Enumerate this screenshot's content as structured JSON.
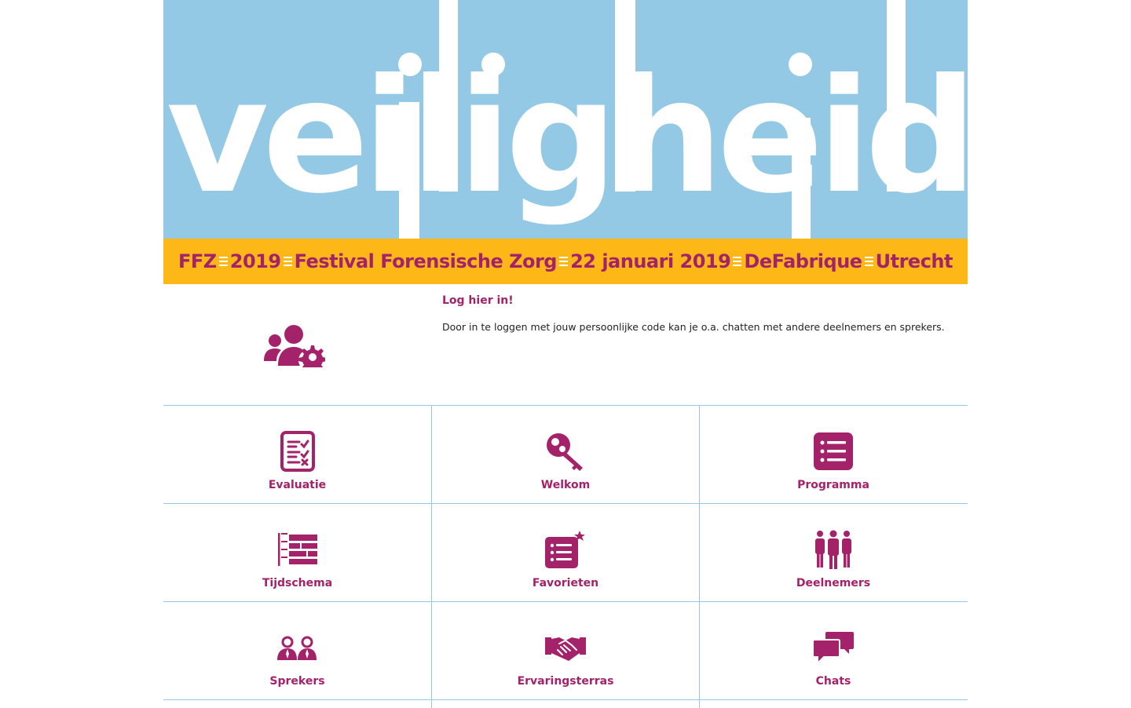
{
  "colors": {
    "primary": "#a4226a",
    "hero_bg": "#94c9e6",
    "band_bg": "#fdb818",
    "divider": "#94c9e6"
  },
  "hero": {
    "word": "veiligheid"
  },
  "band": {
    "items": [
      "FFZ",
      "2019",
      "Festival Forensische Zorg",
      "22 januari 2019",
      "DeFabrique",
      "Utrecht"
    ]
  },
  "login": {
    "icon": "users-gear-icon",
    "title": "Log hier in!",
    "text": "Door in te loggen met jouw persoonlijke code kan je o.a. chatten met andere deelnemers en sprekers."
  },
  "tiles": [
    {
      "label": "Evaluatie",
      "icon": "checklist-icon"
    },
    {
      "label": "Welkom",
      "icon": "key-icon"
    },
    {
      "label": "Programma",
      "icon": "list-icon"
    },
    {
      "label": "Tijdschema",
      "icon": "schedule-icon"
    },
    {
      "label": "Favorieten",
      "icon": "favorite-list-icon"
    },
    {
      "label": "Deelnemers",
      "icon": "people-icon"
    },
    {
      "label": "Sprekers",
      "icon": "speakers-icon"
    },
    {
      "label": "Ervaringsterras",
      "icon": "handshake-icon"
    },
    {
      "label": "Chats",
      "icon": "chat-icon"
    }
  ]
}
